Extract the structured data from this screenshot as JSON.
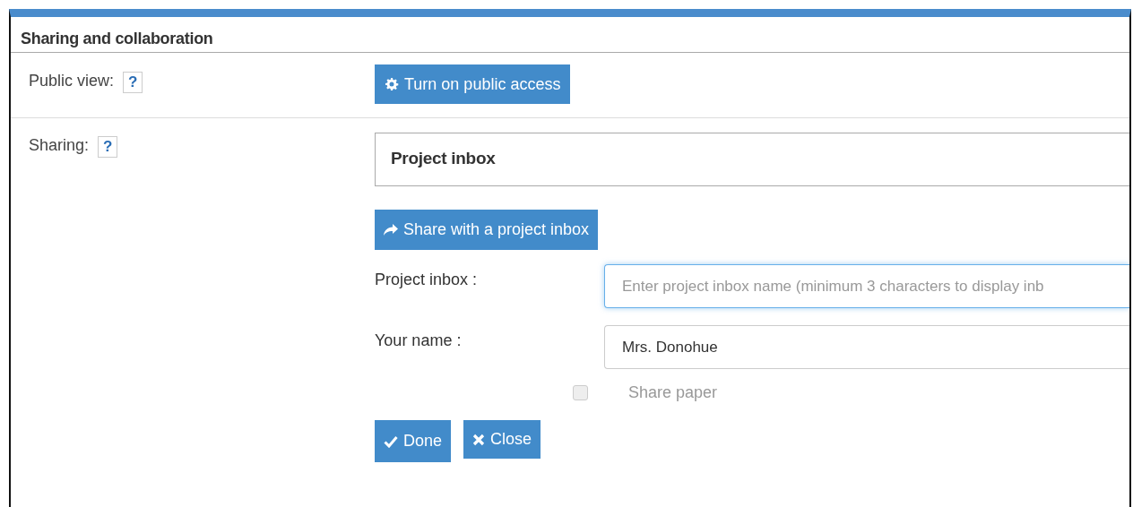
{
  "panel": {
    "title": "Sharing and collaboration"
  },
  "public_view": {
    "label": "Public view:",
    "help": "?",
    "button": "Turn on public access"
  },
  "sharing": {
    "label": "Sharing:",
    "help": "?",
    "box_title": "Project inbox",
    "share_button": "Share with a project inbox",
    "fields": [
      {
        "label": "Project inbox :",
        "placeholder": "Enter project inbox name (minimum 3 characters to display inb",
        "focused": true
      },
      {
        "label": "Your name :",
        "value": "Mrs. Donohue",
        "focused": false
      }
    ],
    "checkbox": {
      "label": "Share paper",
      "checked": false,
      "disabled": true
    },
    "buttons": [
      {
        "kind": "done",
        "label": "Done"
      },
      {
        "kind": "close",
        "label": "Close"
      }
    ]
  }
}
